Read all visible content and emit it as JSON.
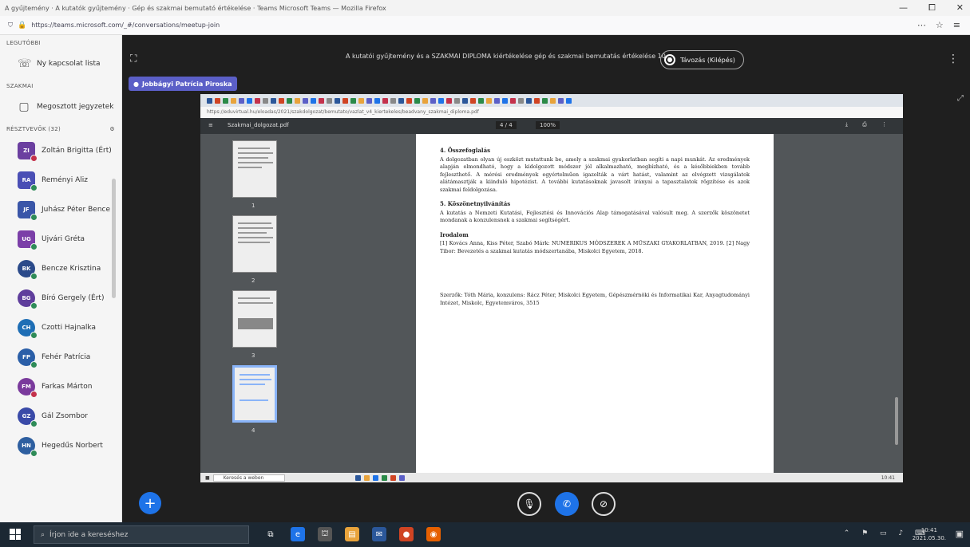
{
  "browser": {
    "window_title": "A gyűjtemény · A kutatók gyűjtemény · Gép és szakmai bemutató értékelése · Teams Microsoft Teams — Mozilla Firefox",
    "url": "https://teams.microsoft.com/_#/conversations/meetup-join",
    "min_label": "—",
    "max_label": "⧠",
    "close_label": "✕"
  },
  "sidebar": {
    "section_recent": "LEGUTÓBBI",
    "nav_items": [
      {
        "label": "Ny kapcsolat lista",
        "icon": "☏"
      },
      {
        "label": "Megosztott jegyzetek",
        "icon": "▢"
      }
    ],
    "section_shared": "SZAKMAI",
    "section_participants": "RÉSZTVEVŐK (32)",
    "participants": [
      {
        "initials": "ZI",
        "name": "Zoltán Brigitta (Ért)",
        "color": "#6b3fa0",
        "status": "#c4314b",
        "square": true
      },
      {
        "initials": "RA",
        "name": "Reményi Aliz",
        "color": "#4a4fb5",
        "status": "#2e8b57",
        "square": true
      },
      {
        "initials": "JF",
        "name": "Juhász Péter Bence",
        "color": "#3a56a8",
        "status": "#2e8b57",
        "square": true
      },
      {
        "initials": "UG",
        "name": "Ujvári Gréta",
        "color": "#7b3fa8",
        "status": "#2e8b57",
        "square": true
      },
      {
        "initials": "BK",
        "name": "Bencze Krisztina",
        "color": "#2b4a8a",
        "status": "#2e8b57",
        "square": false
      },
      {
        "initials": "BG",
        "name": "Bíró Gergely (Ért)",
        "color": "#5f3e9c",
        "status": "#2e8b57",
        "square": false
      },
      {
        "initials": "CH",
        "name": "Czotti Hajnalka",
        "color": "#1e6eb5",
        "status": "#2e8b57",
        "square": false
      },
      {
        "initials": "FP",
        "name": "Fehér Patrícia",
        "color": "#2b5fa8",
        "status": "#2e8b57",
        "square": false
      },
      {
        "initials": "FM",
        "name": "Farkas Márton",
        "color": "#7a3a9c",
        "status": "#c4314b",
        "square": false
      },
      {
        "initials": "GZ",
        "name": "Gál Zsombor",
        "color": "#3a4aa8",
        "status": "#2e8b57",
        "square": false
      },
      {
        "initials": "HN",
        "name": "Hegedűs Norbert",
        "color": "#2e5fa0",
        "status": "#2e8b57",
        "square": false
      }
    ]
  },
  "meeting": {
    "title": "A kutatói gyűjtemény és a SZAKMAI DIPLOMA kiértékelése gép és szakmai bemutatás értékelése 10...",
    "leave_label": "Távozás (Kilépés)",
    "presenter": "Jobbágyi Patrícia Piroska"
  },
  "pdf": {
    "url": "https://eduvirtual.hu/eloadas/2021/szakdolgozat/bemutato/vazlat_v4_kiertekeles/beadvany_szakmai_diploma.pdf",
    "toolbar_title": "Szakmai_dolgozat.pdf",
    "page_indicator": "4 / 4",
    "zoom": "100%",
    "tools": "⤓ ⎙ ⋮",
    "thumb_labels": [
      "1",
      "2",
      "3",
      "4"
    ],
    "section4_title": "4. Összefoglalás",
    "section4_body": "A dolgozatban olyan új eszközt mutattunk be, amely a szakmai gyakorlatban segíti a napi munkát. Az eredmények alapján elmondható, hogy a kidolgozott módszer jól alkalmazható, megbízható, és a későbbiekben tovább fejleszthető. A mérési eredmények egyértelműen igazolták a várt hatást, valamint az elvégzett vizsgálatok alátámasztják a kiinduló hipotézist. A további kutatásoknak javasolt irányai a tapasztalatok rögzítése és azok szakmai feldolgozása.",
    "section5_title": "5. Köszönetnyilvánítás",
    "section5_body": "A kutatás a Nemzeti Kutatási, Fejlesztési és Innovációs Alap támogatásával valósult meg. A szerzők köszönetet mondanak a konzulensnek a szakmai segítségért.",
    "refs_title": "Irodalom",
    "refs_body": "[1] Kovács Anna, Kiss Péter, Szabó Márk: NUMERIKUS MÓDSZEREK A MŰSZAKI GYAKORLATBAN, 2019. [2] Nagy Tibor: Bevezetés a szakmai kutatás módszertanába, Miskolci Egyetem, 2018.",
    "authors_body": "Szerzők: Tóth Mária, konzulens: Rácz Péter, Miskolci Egyetem, Gépészmérnöki és Informatikai Kar, Anyagtudományi Intézet, Miskolc, Egyetemváros, 3515"
  },
  "inner_taskbar": {
    "search_placeholder": "Keresés a weben",
    "clock": "10:41"
  },
  "taskbar": {
    "search_placeholder": "Írjon ide a kereséshez",
    "time": "10:41",
    "date": "2021.05.30."
  }
}
